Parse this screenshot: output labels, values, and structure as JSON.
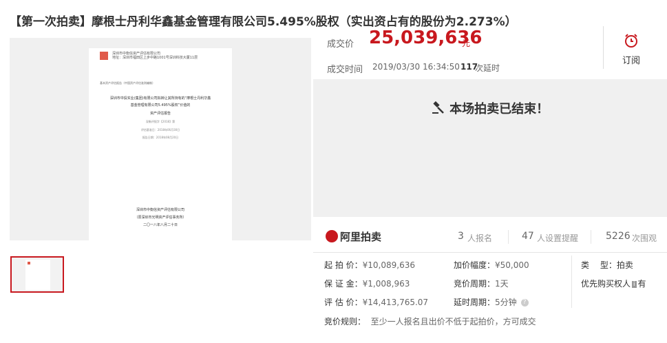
{
  "title": "【第一次拍卖】摩根士丹利华鑫基金管理有限公司5.495%股权（实出资占有的股份为2.273%）",
  "gallery": {
    "doc_header": "深圳市中衡信资产评估有限公司",
    "doc_header_sub": "地址：深圳市福田区上步中路1001号深圳科技大厦11层",
    "doc_line1": "基本资产评估报告（中国资产评估准则编制）",
    "doc_title1": "深圳市中投实业(集团)有限公司拟转让其所持有的“摩根士丹利华鑫",
    "doc_title2": "基金管理有限公司5.495%股权”价值的",
    "doc_title3": "资产评估报告",
    "doc_meta1": "深衡评报字【2018】第",
    "doc_meta2": "评估基准日：2018年06月30日",
    "doc_meta3": "报告日期：2018年08月20日",
    "doc_footer1": "深圳市中衡信资产评估有限公司",
    "doc_footer2": "（原深圳市光明资产评估事务所）",
    "doc_footer3": "二〇一八年八月二十日"
  },
  "deal": {
    "price_label": "成交价",
    "price": "25,039,636",
    "unit": "元",
    "time_label": "成交时间",
    "time": "2019/03/30 16:34:50",
    "extend_count": "117",
    "extend_suffix": "次延时"
  },
  "subscribe": {
    "label": "订阅",
    "icon": "alarm-clock-icon"
  },
  "ended": {
    "icon": "gavel-icon",
    "message": "本场拍卖已结束！"
  },
  "stats": {
    "brand": "阿里拍卖",
    "signups": "3",
    "signups_label": "人报名",
    "reminders": "47",
    "reminders_label": "人设置提醒",
    "views": "5226",
    "views_label": "次围观"
  },
  "info": {
    "start_label": "起 拍 价：",
    "start_value": "¥10,089,636",
    "deposit_label": "保 证 金：",
    "deposit_value": "¥1,008,963",
    "appraisal_label": "评 估 价：",
    "appraisal_value": "¥14,413,765.07",
    "increment_label": "加价幅度：",
    "increment_value": "¥50,000",
    "period_label": "竞价周期：",
    "period_value": "1天",
    "delay_label": "延时周期：",
    "delay_value": "5分钟",
    "type_label": "类　 型：",
    "type_value": "拍卖",
    "priority_label": "优先购买权人",
    "priority_badge": "有",
    "priority_value": "有",
    "rule_label": "竞价规则：",
    "rule_value": "至少一人报名且出价不低于起拍价，方可成交"
  },
  "colors": {
    "accent": "#c8181e",
    "panel": "#f0f0f0"
  }
}
